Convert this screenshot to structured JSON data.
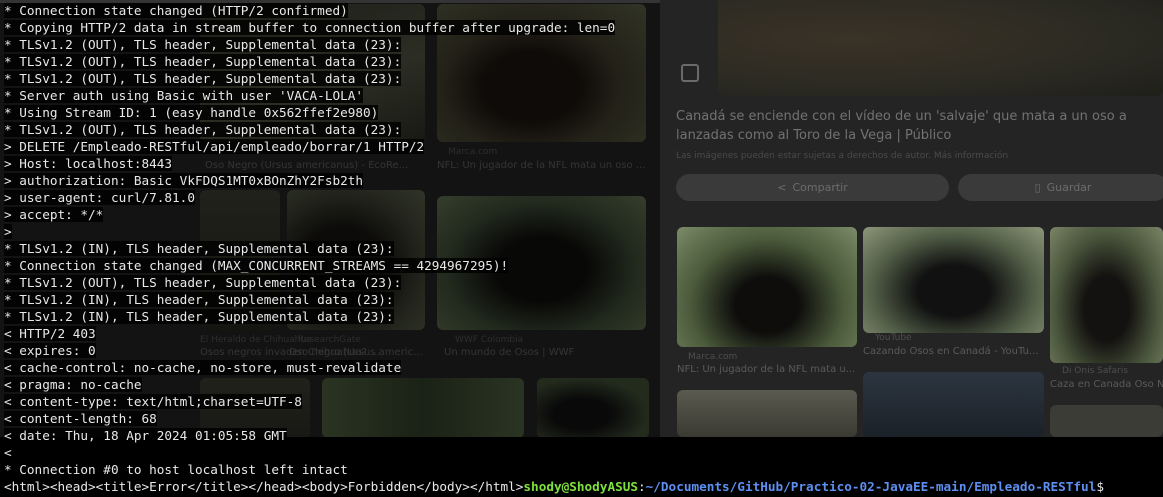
{
  "terminal": {
    "lines": [
      "* Connection state changed (HTTP/2 confirmed)",
      "* Copying HTTP/2 data in stream buffer to connection buffer after upgrade: len=0",
      "* TLSv1.2 (OUT), TLS header, Supplemental data (23):",
      "* TLSv1.2 (OUT), TLS header, Supplemental data (23):",
      "* TLSv1.2 (OUT), TLS header, Supplemental data (23):",
      "* Server auth using Basic with user 'VACA-LOLA'",
      "* Using Stream ID: 1 (easy handle 0x562ffef2e980)",
      "* TLSv1.2 (OUT), TLS header, Supplemental data (23):",
      "> DELETE /Empleado-RESTful/api/empleado/borrar/1 HTTP/2",
      "> Host: localhost:8443",
      "> authorization: Basic VkFDQS1MT0xBOnZhY2Fsb2th",
      "> user-agent: curl/7.81.0",
      "> accept: */*",
      ">",
      "* TLSv1.2 (IN), TLS header, Supplemental data (23):",
      "* Connection state changed (MAX_CONCURRENT_STREAMS == 4294967295)!",
      "* TLSv1.2 (OUT), TLS header, Supplemental data (23):",
      "* TLSv1.2 (IN), TLS header, Supplemental data (23):",
      "* TLSv1.2 (IN), TLS header, Supplemental data (23):",
      "< HTTP/2 403",
      "< expires: 0",
      "< cache-control: no-cache, no-store, must-revalidate",
      "< pragma: no-cache",
      "< content-type: text/html;charset=UTF-8",
      "< content-length: 68",
      "< date: Thu, 18 Apr 2024 01:05:58 GMT",
      "<",
      "* Connection #0 to host localhost left intact"
    ],
    "last_output": "<html><head><title>Error</title></head><body>Forbidden</body></html>",
    "prompt_user": "shody@ShodyASUS",
    "prompt_sep": ":",
    "prompt_path": "~/Documents/GitHub/Practico-02-JavaEE-main/Empleado-RESTful",
    "prompt_symbol": "$",
    "colors": {
      "user": "#7ee03c",
      "path": "#5c8ff0",
      "text": "#e9e9e9",
      "background": "#000000"
    }
  },
  "background_page": {
    "panel_title": "Canadá se enciende con el vídeo de un 'salvaje' que mata a un oso a lanzadas como al Toro de la Vega | Público",
    "panel_rights": "Las imágenes pueden estar sujetas a derechos de autor. Más información",
    "share_label": "Compartir",
    "save_label": "Guardar",
    "captions": {
      "c1_src": "Marca.com",
      "c1_text": "NFL: Un jugador de la NFL mata un oso ...",
      "c2_text": "Oso Negro (Ursus americanus) - EcoRe...",
      "c3_src": "El Heraldo de Chihuahua",
      "c3_text": "Osos negros invaden Chihuahua? ...",
      "c4_src": "ResearchGate",
      "c4_text": "Oso negro (Ursus americ...",
      "c5_src": "WWF Colombia",
      "c5_text": "Un mundo de Osos | WWF",
      "r1_src": "Marca.com",
      "r1_text": "NFL: Un jugador de la NFL mata u...",
      "r2_src": "YouTube",
      "r2_text": "Cazando Osos en Canadá - YouTu...",
      "r3_src": "Di Onis Safaris",
      "r3_text": "Caza en Canada Oso N..."
    }
  }
}
